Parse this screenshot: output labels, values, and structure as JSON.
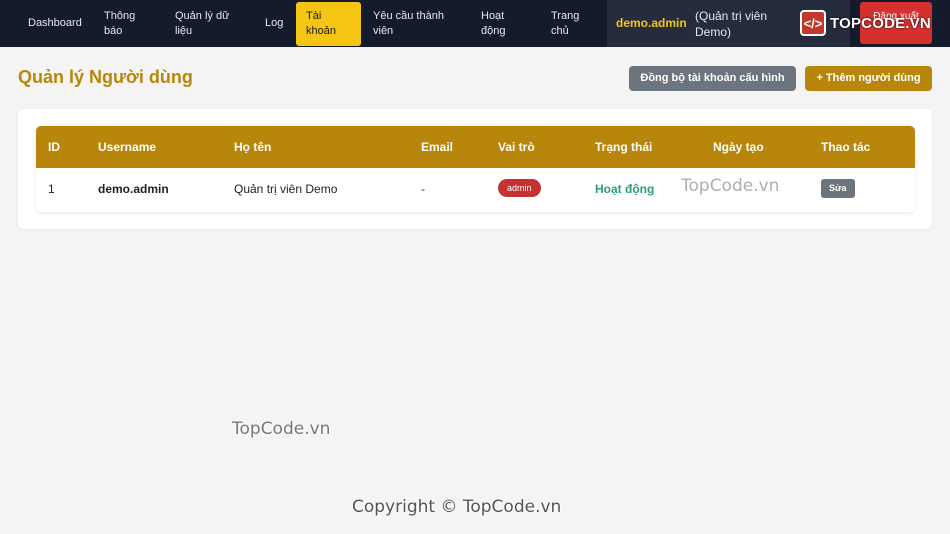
{
  "nav": {
    "items": [
      {
        "label": "Dashboard"
      },
      {
        "label": "Thông báo"
      },
      {
        "label": "Quản lý dữ liệu"
      },
      {
        "label": "Log"
      },
      {
        "label": "Tài khoản"
      },
      {
        "label": "Yêu cầu thành viên"
      },
      {
        "label": "Hoạt động"
      },
      {
        "label": "Trang chủ"
      }
    ],
    "user_name": "demo.admin",
    "user_role": "(Quản trị viên Demo)",
    "logout_label": "Đăng xuất",
    "logo_text": "TOPCODE.VN"
  },
  "page": {
    "title": "Quản lý Người dùng",
    "sync_button": "Đồng bộ tài khoản cấu hình",
    "add_button": "+ Thêm người dùng"
  },
  "table": {
    "headers": [
      "ID",
      "Username",
      "Họ tên",
      "Email",
      "Vai trò",
      "Trạng thái",
      "Ngày tạo",
      "Thao tác"
    ],
    "rows": [
      {
        "id": "1",
        "username": "demo.admin",
        "fullname": "Quản trị viên Demo",
        "email": "-",
        "role": "admin",
        "status": "Hoạt động",
        "created": "",
        "action": "Sửa"
      }
    ]
  },
  "watermarks": {
    "row": "TopCode.vn",
    "middle": "TopCode.vn",
    "copyright": "Copyright © TopCode.vn"
  },
  "colors": {
    "navbar": "#141b2d",
    "accent": "#f4c613",
    "brand": "#b8860b",
    "danger": "#c53030",
    "success": "#2a9d7a",
    "secondary": "#6c757d"
  }
}
